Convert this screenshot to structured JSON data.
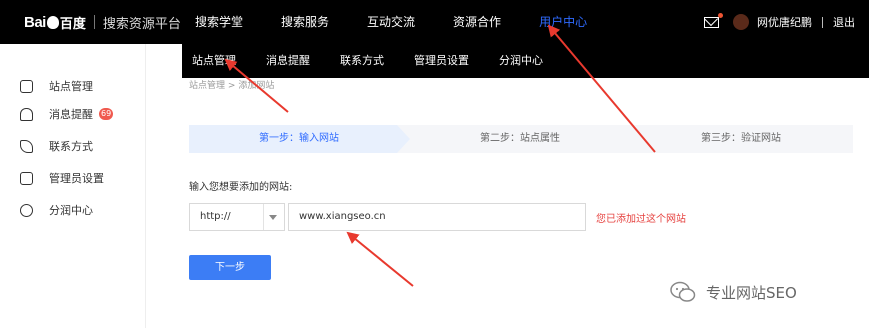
{
  "brand": {
    "logo_bai": "Bai",
    "logo_du": "百度",
    "platform": "搜索资源平台"
  },
  "topnav": [
    "搜索学堂",
    "搜索服务",
    "互动交流",
    "资源合作",
    "用户中心"
  ],
  "topnav_active": "用户中心",
  "topright": {
    "username": "网优唐纪鹏",
    "logout": "退出"
  },
  "subnav": [
    "站点管理",
    "消息提醒",
    "联系方式",
    "管理员设置",
    "分润中心"
  ],
  "sidebar": [
    {
      "label": "站点管理",
      "icon": "site-icon"
    },
    {
      "label": "消息提醒",
      "icon": "bell-icon",
      "badge": "69"
    },
    {
      "label": "联系方式",
      "icon": "phone-icon"
    },
    {
      "label": "管理员设置",
      "icon": "admin-icon"
    },
    {
      "label": "分润中心",
      "icon": "share-icon"
    }
  ],
  "breadcrumb": {
    "root": "站点管理",
    "sep": ">",
    "current": "添加网站"
  },
  "steps": [
    "第一步：输入网站",
    "第二步：站点属性",
    "第三步：验证网站"
  ],
  "form": {
    "label": "输入您想要添加的网站:",
    "protocol": "http://",
    "url": "www.xiangseo.cn",
    "error": "您已添加过这个网站",
    "next": "下一步"
  },
  "watermark": "专业网站SEO",
  "colors": {
    "accent": "#2f6bff",
    "error": "#e64340",
    "arrow": "#e8392e",
    "button": "#3c7df5"
  }
}
